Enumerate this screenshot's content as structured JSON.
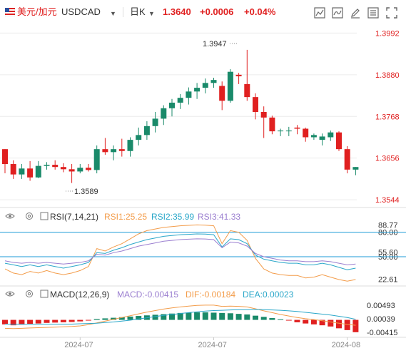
{
  "header": {
    "pair_name": "美元/加元",
    "symbol": "USDCAD",
    "timeframe": "日K",
    "price": "1.3640",
    "change": "+0.0006",
    "change_pct": "+0.04%",
    "icons": [
      "flag-icon",
      "dropdown-caret-icon",
      "timeframe-dropdown-icon",
      "chart-type-icon",
      "indicator-icon",
      "draw-icon",
      "settings-icon",
      "fullscreen-icon"
    ]
  },
  "colors": {
    "up": "#1a8a6a",
    "down": "#e02020",
    "price_label": "#e02020",
    "change": "#e02020",
    "grid": "#ececec",
    "divider": "#dddddd",
    "ref_line": "#1e9bd7",
    "rsi1": "#f39c4a",
    "rsi2": "#2aa7c9",
    "rsi3": "#9b7fd0",
    "macd": "#9b7fd0",
    "dif": "#f39c4a",
    "dea": "#2aa7c9"
  },
  "chart_data": [
    {
      "type": "candlestick",
      "y_ticks": [
        "1.3992",
        "1.3880",
        "1.3768",
        "1.3656",
        "1.3544"
      ],
      "ylim": [
        1.3525,
        1.4012
      ],
      "x_ticks": [
        "2024-07",
        "2024-07",
        "2024-08"
      ],
      "annotations": {
        "high": "1.3947",
        "low": "1.3589"
      },
      "candles": [
        [
          1.368,
          1.368,
          1.3615,
          1.364
        ],
        [
          1.364,
          1.365,
          1.36,
          1.3612
        ],
        [
          1.3612,
          1.364,
          1.36,
          1.3628
        ],
        [
          1.3628,
          1.3648,
          1.3595,
          1.3604
        ],
        [
          1.3604,
          1.3648,
          1.3602,
          1.3635
        ],
        [
          1.3635,
          1.3645,
          1.3625,
          1.3638
        ],
        [
          1.3638,
          1.365,
          1.3625,
          1.3632
        ],
        [
          1.3632,
          1.3642,
          1.3618,
          1.3626
        ],
        [
          1.3626,
          1.364,
          1.3589,
          1.362
        ],
        [
          1.362,
          1.364,
          1.3615,
          1.363
        ],
        [
          1.363,
          1.364,
          1.362,
          1.3624
        ],
        [
          1.3624,
          1.369,
          1.3615,
          1.368
        ],
        [
          1.368,
          1.371,
          1.3665,
          1.3672
        ],
        [
          1.3672,
          1.369,
          1.365,
          1.368
        ],
        [
          1.368,
          1.3708,
          1.366,
          1.3675
        ],
        [
          1.3675,
          1.3712,
          1.366,
          1.3705
        ],
        [
          1.3705,
          1.3738,
          1.369,
          1.3718
        ],
        [
          1.3718,
          1.3755,
          1.3705,
          1.3742
        ],
        [
          1.3742,
          1.378,
          1.3725,
          1.3762
        ],
        [
          1.3762,
          1.3798,
          1.3745,
          1.379
        ],
        [
          1.379,
          1.3815,
          1.3768,
          1.3805
        ],
        [
          1.3805,
          1.3828,
          1.3788,
          1.3818
        ],
        [
          1.3818,
          1.3846,
          1.38,
          1.3835
        ],
        [
          1.3835,
          1.3858,
          1.3815,
          1.3845
        ],
        [
          1.3845,
          1.387,
          1.383,
          1.3858
        ],
        [
          1.3858,
          1.3872,
          1.3845,
          1.3866
        ],
        [
          1.385,
          1.3862,
          1.3785,
          1.381
        ],
        [
          1.381,
          1.3895,
          1.3805,
          1.3888
        ],
        [
          1.388,
          1.3885,
          1.3855,
          1.3876
        ],
        [
          1.3855,
          1.3947,
          1.381,
          1.382
        ],
        [
          1.382,
          1.383,
          1.376,
          1.378
        ],
        [
          1.378,
          1.3795,
          1.371,
          1.3765
        ],
        [
          1.3765,
          1.377,
          1.372,
          1.3728
        ],
        [
          1.3728,
          1.3735,
          1.3715,
          1.373
        ],
        [
          1.3728,
          1.374,
          1.3715,
          1.373
        ],
        [
          1.3738,
          1.3745,
          1.372,
          1.3735
        ],
        [
          1.3735,
          1.3738,
          1.37,
          1.3712
        ],
        [
          1.3712,
          1.3722,
          1.3705,
          1.3718
        ],
        [
          1.3705,
          1.3722,
          1.369,
          1.3714
        ],
        [
          1.3712,
          1.373,
          1.3702,
          1.3725
        ],
        [
          1.3725,
          1.3728,
          1.3675,
          1.368
        ],
        [
          1.368,
          1.3688,
          1.3615,
          1.3625
        ],
        [
          1.3625,
          1.3632,
          1.361,
          1.3632
        ]
      ]
    },
    {
      "type": "line",
      "name": "RSI",
      "params": "RSI(7,14,21)",
      "legend": [
        {
          "label": "RSI1:25.25",
          "color": "#f39c4a"
        },
        {
          "label": "RSI2:35.99",
          "color": "#2aa7c9"
        },
        {
          "label": "RSI3:41.33",
          "color": "#9b7fd0"
        }
      ],
      "y_ticks": [
        "88.77",
        "80.00",
        "55.60",
        "50.00",
        "22.61"
      ],
      "ylim": [
        15,
        92
      ],
      "reference_lines": [
        80,
        50
      ],
      "series": [
        {
          "name": "RSI1",
          "color": "#f39c4a",
          "values": [
            35,
            30,
            28,
            32,
            30,
            33,
            30,
            28,
            30,
            33,
            38,
            60,
            57,
            62,
            66,
            72,
            78,
            82,
            84,
            86,
            87,
            88,
            88.5,
            89,
            88.8,
            88,
            66,
            82,
            80,
            70,
            48,
            35,
            30,
            28,
            27,
            27,
            24,
            25,
            28,
            25,
            22,
            20,
            22
          ]
        },
        {
          "name": "RSI2",
          "color": "#2aa7c9",
          "values": [
            42,
            40,
            38,
            40,
            38,
            40,
            38,
            36,
            38,
            40,
            43,
            55,
            54,
            58,
            61,
            65,
            68,
            71,
            73,
            75,
            76,
            77,
            77.5,
            78,
            77.8,
            77,
            62,
            72,
            71,
            66,
            52,
            47,
            45,
            43,
            42,
            42,
            40,
            40,
            42,
            40,
            37,
            34,
            36
          ]
        },
        {
          "name": "RSI3",
          "color": "#9b7fd0",
          "values": [
            45,
            43,
            42,
            43,
            42,
            43,
            42,
            41,
            42,
            43,
            45,
            53,
            52,
            55,
            57,
            60,
            63,
            65,
            67,
            69,
            70,
            71,
            71.5,
            72,
            71.8,
            71,
            61,
            68,
            67,
            63,
            54,
            50,
            48,
            46,
            45,
            45,
            44,
            44,
            45,
            44,
            42,
            40,
            41
          ]
        }
      ]
    },
    {
      "type": "bar",
      "name": "MACD",
      "params": "MACD(12,26,9)",
      "legend": [
        {
          "label": "MACD:-0.00415",
          "color": "#9b7fd0"
        },
        {
          "label": "DIF:-0.00184",
          "color": "#f39c4a"
        },
        {
          "label": "DEA:0.00023",
          "color": "#2aa7c9"
        }
      ],
      "y_ticks": [
        "0.00493",
        "0.00039",
        "-0.00415"
      ],
      "ylim": [
        -0.0058,
        0.0063
      ],
      "x_ticks": [
        "2024-07",
        "2024-07",
        "2024-08"
      ],
      "series": [
        {
          "name": "MACD",
          "values": [
            -0.0015,
            -0.0018,
            -0.0016,
            -0.0014,
            -0.0012,
            -0.001,
            -0.0009,
            -0.0008,
            -0.0007,
            -0.0005,
            -0.0002,
            0.0003,
            0.0005,
            0.0007,
            0.0009,
            0.0011,
            0.0013,
            0.0015,
            0.0017,
            0.0019,
            0.0021,
            0.0023,
            0.0024,
            0.0025,
            0.0025,
            0.0024,
            0.0023,
            0.0022,
            0.002,
            0.0018,
            0.0014,
            0.001,
            0.0006,
            0.0002,
            -0.0002,
            -0.0008,
            -0.0012,
            -0.0015,
            -0.0018,
            -0.0022,
            -0.0028,
            -0.0034,
            -0.0041
          ]
        },
        {
          "name": "DIF",
          "values": [
            -0.0028,
            -0.0029,
            -0.0028,
            -0.0027,
            -0.0026,
            -0.0025,
            -0.0024,
            -0.0023,
            -0.0022,
            -0.002,
            -0.0016,
            -0.001,
            -0.0004,
            0.0002,
            0.0008,
            0.0014,
            0.002,
            0.0026,
            0.0031,
            0.0036,
            0.004,
            0.0043,
            0.0046,
            0.0048,
            0.0049,
            0.0049,
            0.0045,
            0.0046,
            0.0045,
            0.0043,
            0.0037,
            0.003,
            0.0024,
            0.0018,
            0.0013,
            0.0008,
            0.0004,
            0.0001,
            -0.0003,
            -0.0007,
            -0.0011,
            -0.0015,
            -0.0018
          ]
        },
        {
          "name": "DEA",
          "values": [
            -0.0014,
            -0.0014,
            -0.0014,
            -0.0014,
            -0.0014,
            -0.0014,
            -0.0014,
            -0.0014,
            -0.0014,
            -0.0013,
            -0.0012,
            -0.0011,
            -0.0009,
            -0.0007,
            -0.0004,
            -0.0001,
            0.0003,
            0.0007,
            0.0011,
            0.0015,
            0.0018,
            0.0021,
            0.0024,
            0.0027,
            0.0029,
            0.0031,
            0.0032,
            0.0033,
            0.0034,
            0.0034,
            0.0035,
            0.0034,
            0.0033,
            0.0032,
            0.003,
            0.0028,
            0.0025,
            0.0022,
            0.0019,
            0.0016,
            0.0012,
            0.0008,
            0.0002
          ]
        }
      ]
    }
  ]
}
